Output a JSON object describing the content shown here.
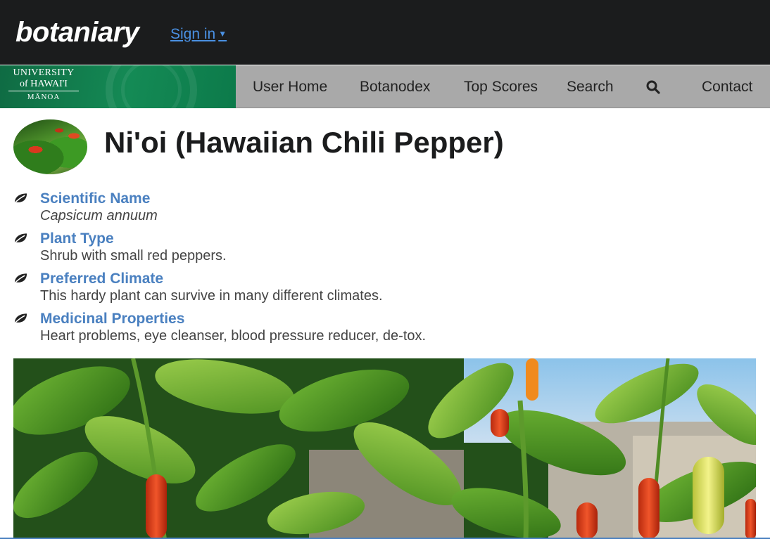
{
  "header": {
    "brand": "botaniary",
    "signin_label": "Sign in",
    "signin_caret": "▼"
  },
  "nav": {
    "logo": {
      "line1": "UNIVERSITY",
      "line2": "of HAWAI'I",
      "line3": "MĀNOA"
    },
    "items": [
      {
        "label": "User Home"
      },
      {
        "label": "Botanodex"
      },
      {
        "label": "Top Scores"
      },
      {
        "label": "Search"
      },
      {
        "label": "Contact"
      }
    ],
    "search_icon": "search-icon"
  },
  "plant": {
    "title": "Ni'oi (Hawaiian Chili Pepper)",
    "attributes": [
      {
        "label": "Scientific Name",
        "value": "Capsicum annuum",
        "icon": "leaf-icon"
      },
      {
        "label": "Plant Type",
        "value": "Shrub with small red peppers.",
        "icon": "leaf-icon"
      },
      {
        "label": "Preferred Climate",
        "value": "This hardy plant can survive in many different climates.",
        "icon": "leaf-icon"
      },
      {
        "label": "Medicinal Properties",
        "value": "Heart problems, eye cleanser, blood pressure reducer, de-tox.",
        "icon": "leaf-icon"
      }
    ]
  },
  "colors": {
    "topbar": "#1b1c1d",
    "navbar": "#a9a9a9",
    "link": "#4a80c0",
    "uh_green": "#148a55"
  }
}
